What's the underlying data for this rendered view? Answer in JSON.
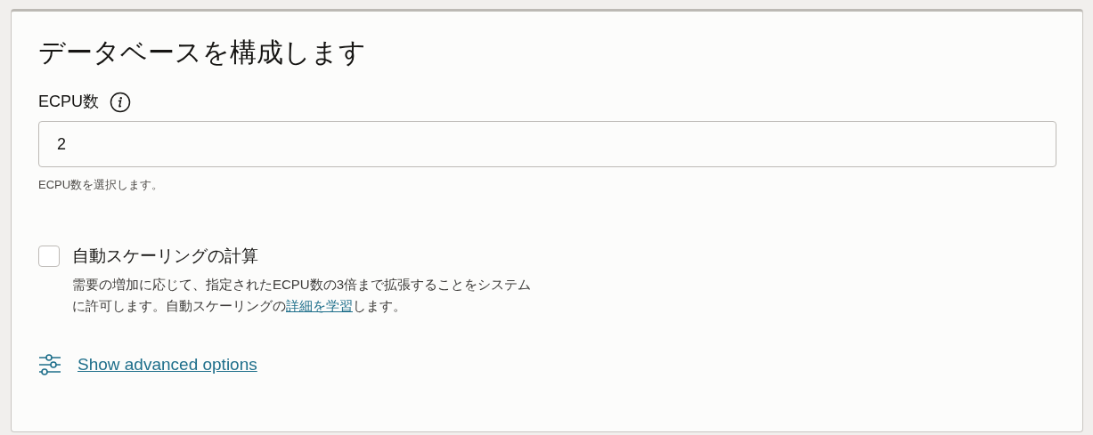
{
  "title": "データベースを構成します",
  "ecpu_field": {
    "label": "ECPU数",
    "value": "2",
    "help": "ECPU数を選択します。"
  },
  "autoscaling": {
    "label": "自動スケーリングの計算",
    "checked": false,
    "description": {
      "before": "需要の増加に応じて、指定されたECPU数の3倍まで拡張することをシステムに許可します。自動スケーリングの",
      "link": "詳細を学習",
      "after": "します。"
    }
  },
  "advanced_link": "Show advanced options"
}
